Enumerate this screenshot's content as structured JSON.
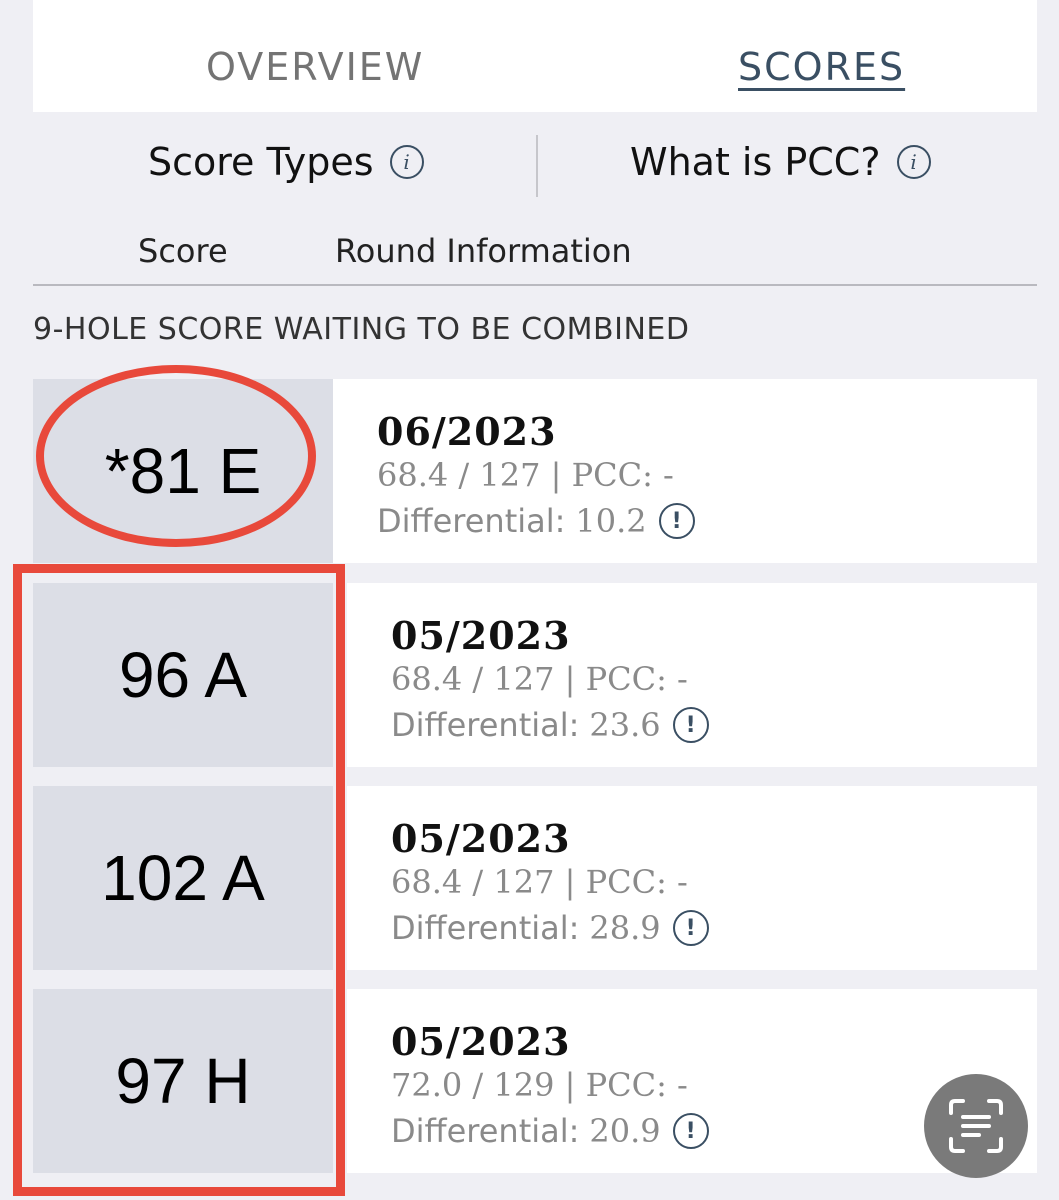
{
  "tabs": {
    "overview": "OVERVIEW",
    "scores": "SCORES"
  },
  "info": {
    "score_types": "Score Types",
    "what_is_pcc": "What is PCC?"
  },
  "columns": {
    "score": "Score",
    "round": "Round Information"
  },
  "section_title": "9-HOLE SCORE WAITING TO BE COMBINED",
  "rows": [
    {
      "score": "*81 E",
      "date": "06/2023",
      "meta": "68.4 / 127 | PCC: -",
      "diff_label": "Differential:",
      "diff_value": "10.2"
    },
    {
      "score": "96 A",
      "date": "05/2023",
      "meta": "68.4 / 127 | PCC: -",
      "diff_label": "Differential:",
      "diff_value": "23.6"
    },
    {
      "score": "102 A",
      "date": "05/2023",
      "meta": "68.4 / 127 | PCC: -",
      "diff_label": "Differential:",
      "diff_value": "28.9"
    },
    {
      "score": "97 H",
      "date": "05/2023",
      "meta": "72.0 / 129 | PCC: -",
      "diff_label": "Differential:",
      "diff_value": "20.9"
    }
  ],
  "icons": {
    "info": "info-icon",
    "alert": "alert-icon",
    "scan": "scan-text-icon"
  },
  "colors": {
    "accent": "#3a4f63",
    "highlight": "#e8493b",
    "score_bg": "#dcdee6"
  }
}
